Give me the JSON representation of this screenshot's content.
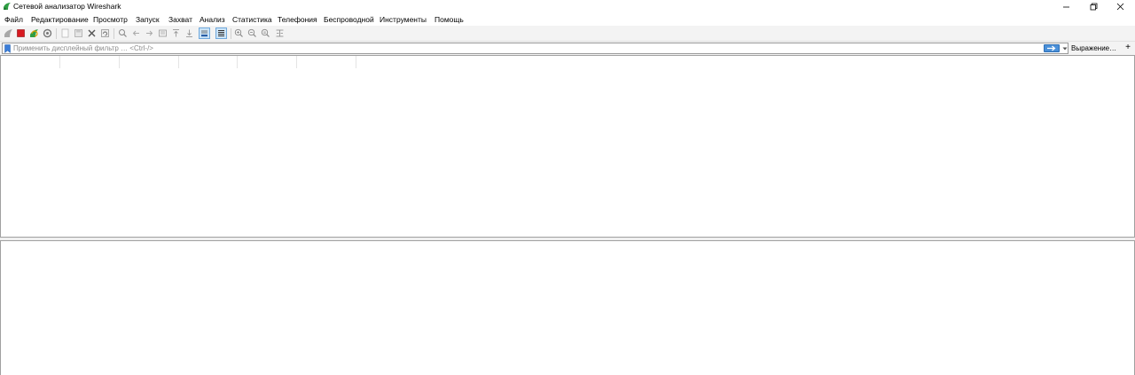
{
  "window": {
    "title": "Сетевой анализатор Wireshark",
    "logo_icon": "wireshark-fin-icon",
    "accent_color": "#2f9e44"
  },
  "menu": {
    "items": [
      "Файл",
      "Редактирование",
      "Просмотр",
      "Запуск",
      "Захват",
      "Анализ",
      "Статистика",
      "Телефония",
      "Беспроводной",
      "Инструменты",
      "Помощь"
    ]
  },
  "toolbar": {
    "buttons": [
      "start-capture-icon",
      "stop-capture-icon",
      "restart-capture-icon",
      "capture-options-icon",
      "open-file-icon",
      "save-file-icon",
      "close-file-icon",
      "reload-file-icon",
      "find-packet-icon",
      "go-back-icon",
      "go-forward-icon",
      "go-to-packet-icon",
      "go-first-icon",
      "go-last-icon",
      "autoscroll-icon",
      "colorize-icon",
      "zoom-in-icon",
      "zoom-out-icon",
      "normal-size-icon",
      "resize-columns-icon"
    ],
    "checked": [
      "autoscroll-icon",
      "colorize-icon"
    ]
  },
  "filter": {
    "placeholder": "Применить дисплейный фильтр … <Ctrl-/>",
    "value": "",
    "apply_icon": "arrow-right-icon",
    "expression_label": "Выражение…",
    "add_label": "+"
  },
  "packet_list": {
    "columns": [
      "",
      "",
      "",
      "",
      "",
      ""
    ]
  }
}
